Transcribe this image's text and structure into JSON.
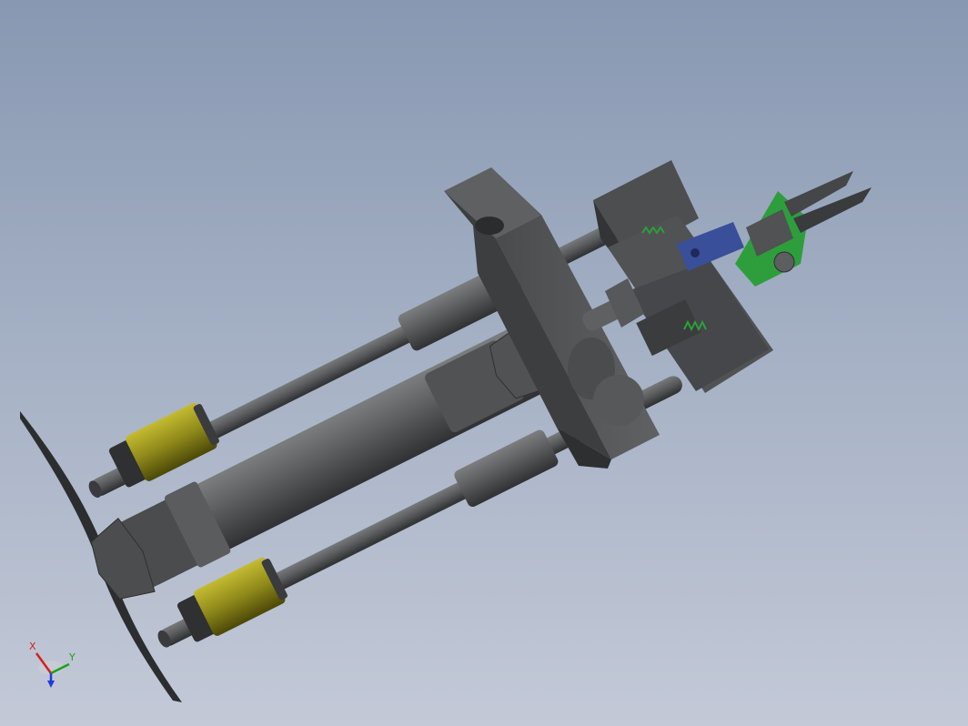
{
  "viewport": {
    "background_top": "#8898b2",
    "background_bottom": "#c3c9d7"
  },
  "model": {
    "colors": {
      "body": "#555759",
      "body_dark": "#38393b",
      "body_light": "#77797b",
      "bushing": "#8f8a1a",
      "bushing_light": "#b5ad2a",
      "accent_green": "#2e9e3c",
      "accent_blue": "#3a4f9a"
    }
  },
  "triad": {
    "x_label": "X",
    "y_label": "Y",
    "x_color": "#d81e1e",
    "y_color": "#1ea01e",
    "z_color": "#1e3cd8"
  }
}
